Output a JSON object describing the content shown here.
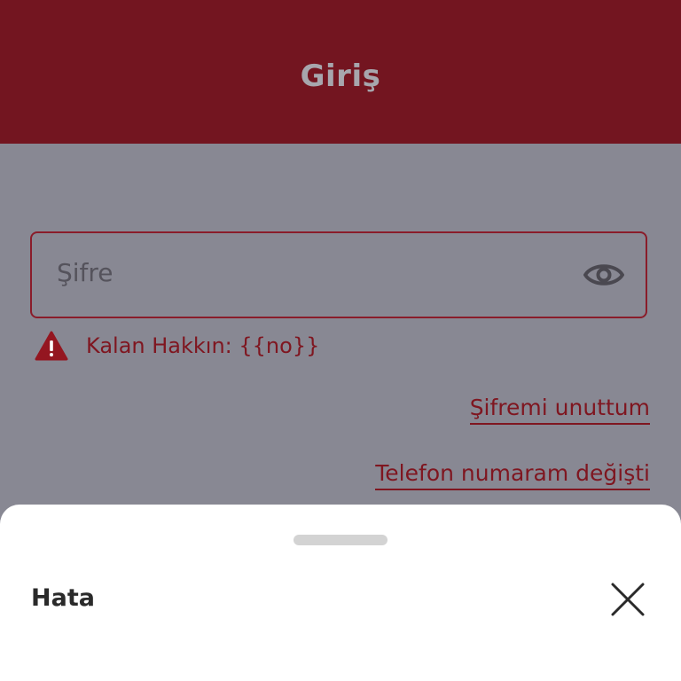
{
  "header": {
    "title": "Giriş"
  },
  "password_field": {
    "placeholder": "Şifre",
    "icon": "eye-icon"
  },
  "warning": {
    "icon": "warning-triangle-icon",
    "text": "Kalan Hakkın: {{no}}"
  },
  "links": {
    "forgot_password": "Şifremi unuttum",
    "phone_changed": "Telefon numaram değişti"
  },
  "bottom_sheet": {
    "title": "Hata",
    "close_icon": "close-icon"
  },
  "colors": {
    "header_bg": "#731520",
    "overlay_bg": "#888893",
    "accent": "#7f1620",
    "sheet_bg": "#ffffff"
  }
}
